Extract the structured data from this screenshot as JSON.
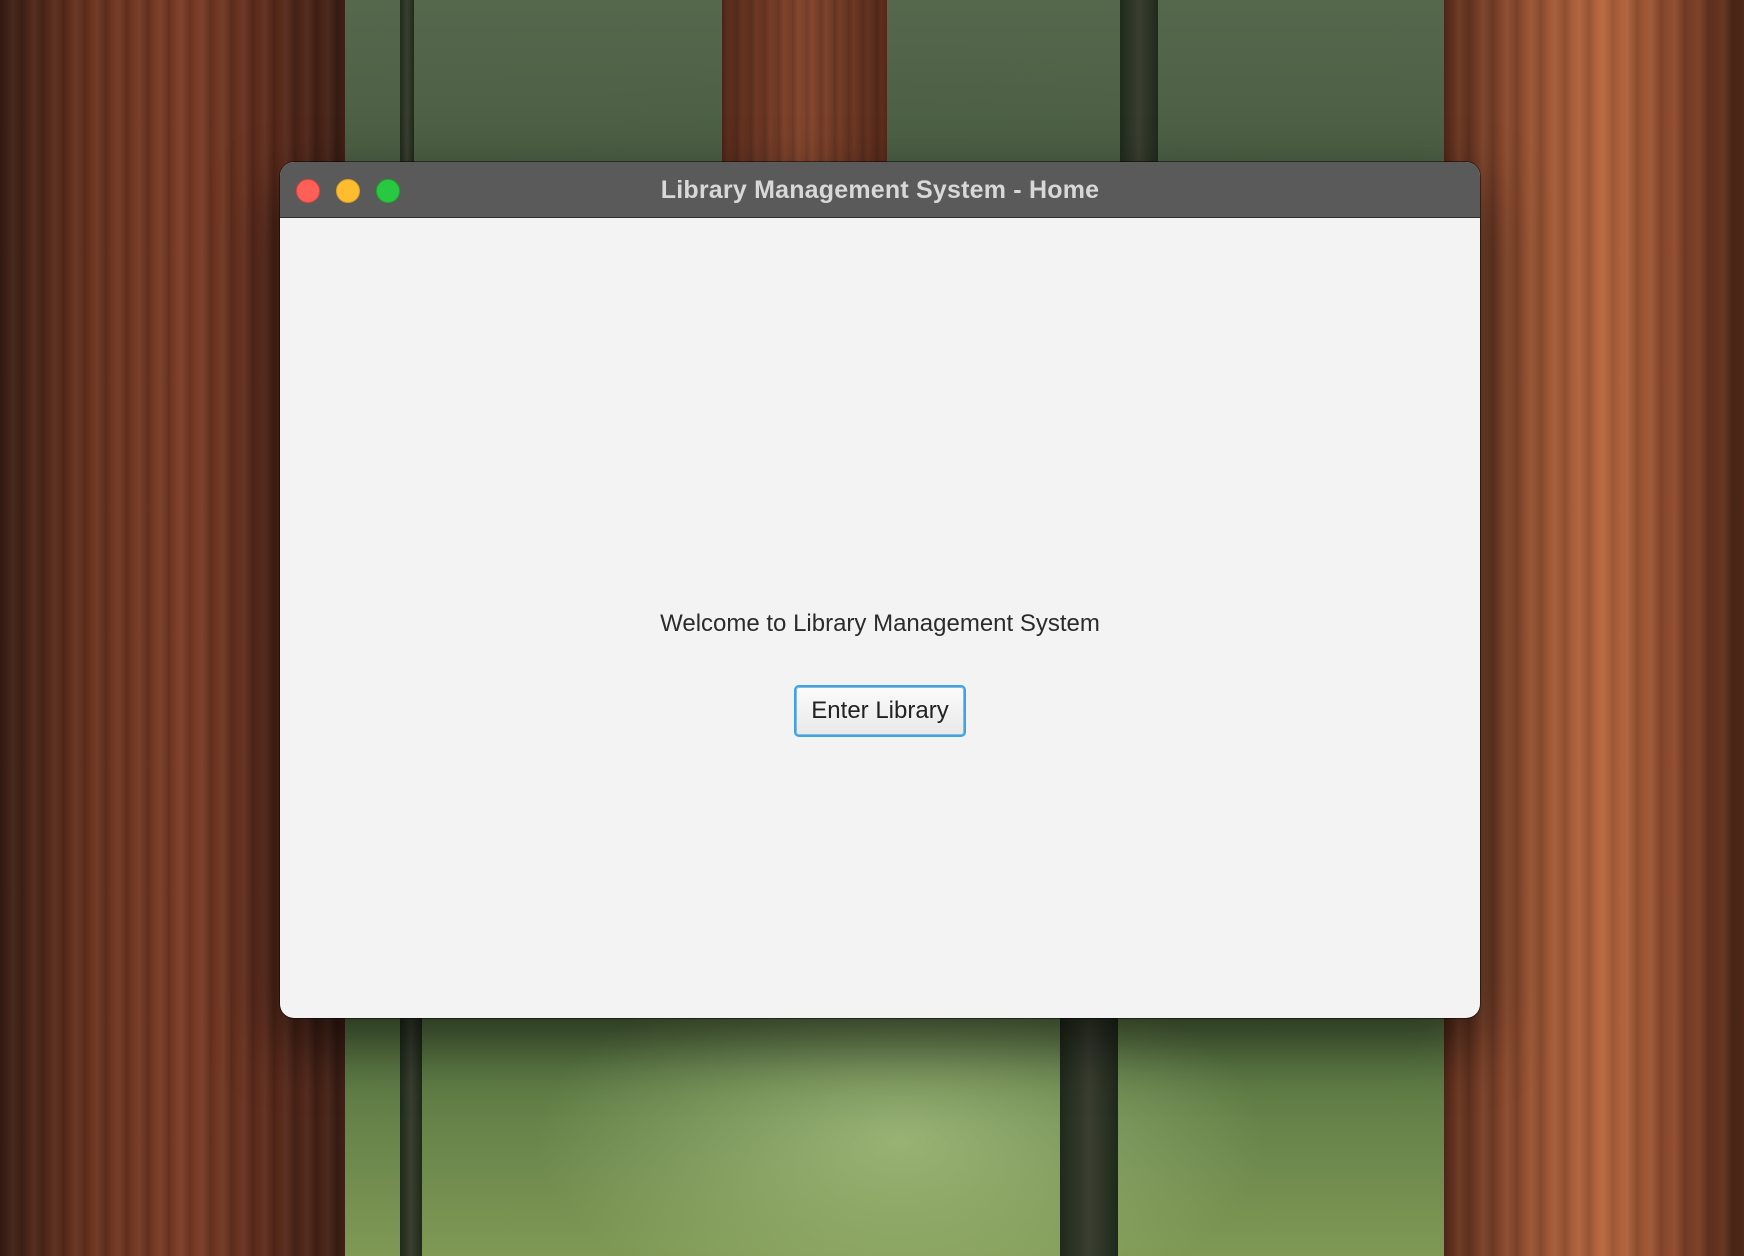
{
  "window": {
    "title": "Library Management System - Home"
  },
  "main": {
    "welcome_text": "Welcome to Library Management System",
    "enter_button_label": "Enter Library"
  },
  "colors": {
    "close": "#fe5f57",
    "minimize": "#febc2e",
    "zoom": "#28c840",
    "focus_ring": "#3aa4e6"
  }
}
